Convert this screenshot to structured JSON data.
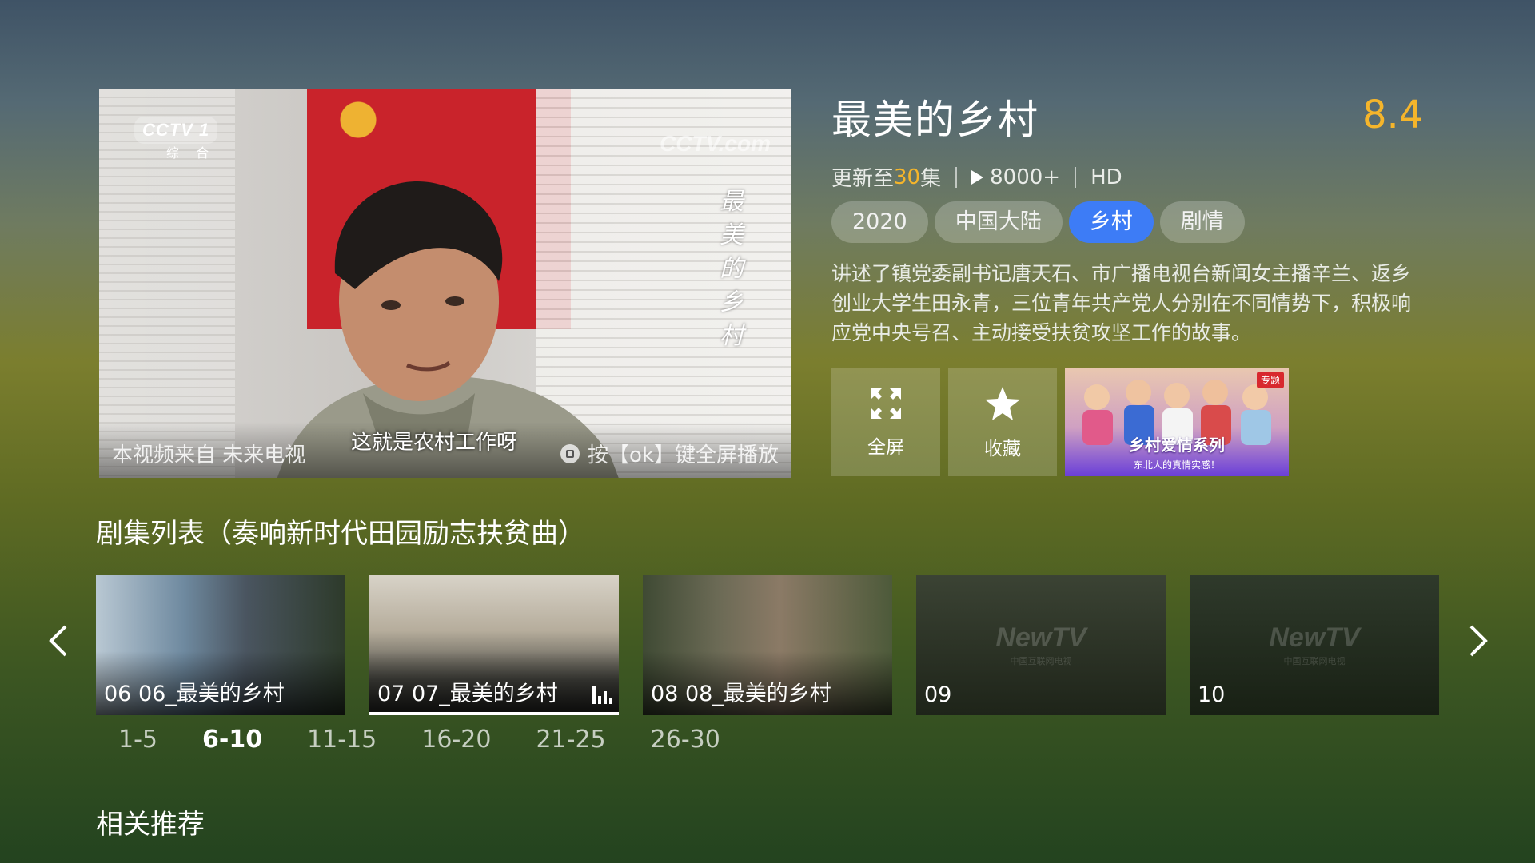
{
  "player": {
    "channel_logo": "CCTV 1",
    "channel_sub": "综 合",
    "watermark": "CCTV.com",
    "vertical_title": [
      "最",
      "美",
      "的",
      "乡",
      "村"
    ],
    "source_text": "本视频来自 未来电视",
    "subtitle": "这就是农村工作呀",
    "ok_hint": "按【ok】键全屏播放"
  },
  "show": {
    "title": "最美的乡村",
    "rating": "8.4",
    "update_prefix": "更新至",
    "update_count": "30",
    "update_suffix": "集",
    "play_count": "8000+",
    "quality": "HD",
    "tags": [
      "2020",
      "中国大陆",
      "乡村",
      "剧情"
    ],
    "active_tag_index": 2,
    "description": "讲述了镇党委副书记唐天石、市广播电视台新闻女主播辛兰、返乡创业大学生田永青，三位青年共产党人分别在不同情势下，积极响应党中央号召、主动接受扶贫攻坚工作的故事。"
  },
  "actions": {
    "fullscreen_label": "全屏",
    "favorite_label": "收藏",
    "promo_badge": "专题",
    "promo_title": "乡村爱情系列",
    "promo_subtitle": "东北人的真情实感！"
  },
  "episodes_section": {
    "title": "剧集列表（奏响新时代田园励志扶贫曲）",
    "episodes": [
      {
        "label": "06 06_最美的乡村"
      },
      {
        "label": "07 07_最美的乡村"
      },
      {
        "label": "08 08_最美的乡村"
      },
      {
        "label": "09",
        "watermark": "NewTV",
        "watermark_sub": "中国互联网电视"
      },
      {
        "label": "10",
        "watermark": "NewTV",
        "watermark_sub": "中国互联网电视"
      }
    ],
    "selected_index": 1,
    "ranges": [
      "1-5",
      "6-10",
      "11-15",
      "16-20",
      "21-25",
      "26-30"
    ],
    "active_range_index": 1
  },
  "related": {
    "title": "相关推荐"
  },
  "colors": {
    "accent_blue": "#3d7cf6",
    "highlight_gold": "#f5b52b"
  },
  "icons": [
    "fullscreen-icon",
    "star-icon",
    "play-count-icon",
    "arrow-left-icon",
    "arrow-right-icon",
    "playing-bars-icon",
    "ok-button-icon"
  ]
}
